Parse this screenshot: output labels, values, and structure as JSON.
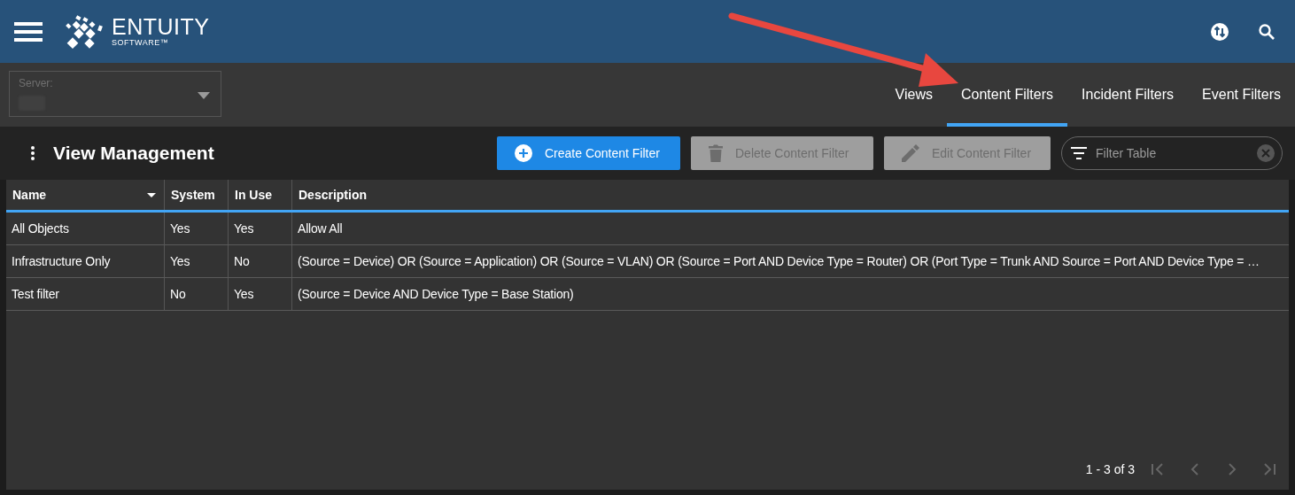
{
  "header": {
    "logo_text": "ENTUITY",
    "logo_subtext": "SOFTWARE™"
  },
  "server": {
    "label": "Server:"
  },
  "tabs": [
    {
      "label": "Views",
      "selected": false
    },
    {
      "label": "Content Filters",
      "selected": true
    },
    {
      "label": "Incident Filters",
      "selected": false
    },
    {
      "label": "Event Filters",
      "selected": false
    }
  ],
  "page_title": "View Management",
  "buttons": [
    {
      "label": "Create Content Filter",
      "kind": "create",
      "disabled": false
    },
    {
      "label": "Delete Content Filter",
      "kind": "delete",
      "disabled": true
    },
    {
      "label": "Edit Content Filter",
      "kind": "edit",
      "disabled": true
    }
  ],
  "search": {
    "placeholder": "Filter Table"
  },
  "table": {
    "columns": [
      "Name",
      "System",
      "In Use",
      "Description"
    ],
    "rows": [
      [
        "All Objects",
        "Yes",
        "Yes",
        "Allow All"
      ],
      [
        "Infrastructure Only",
        "Yes",
        "No",
        "(Source = Device) OR (Source = Application) OR (Source = VLAN) OR (Source = Port AND Device Type = Router) OR (Port Type = Trunk AND Source = Port AND Device Type = …"
      ],
      [
        "Test filter",
        "No",
        "Yes",
        "(Source = Device AND Device Type = Base Station)"
      ]
    ]
  },
  "pagination": {
    "range": "1 - 3 of 3"
  }
}
